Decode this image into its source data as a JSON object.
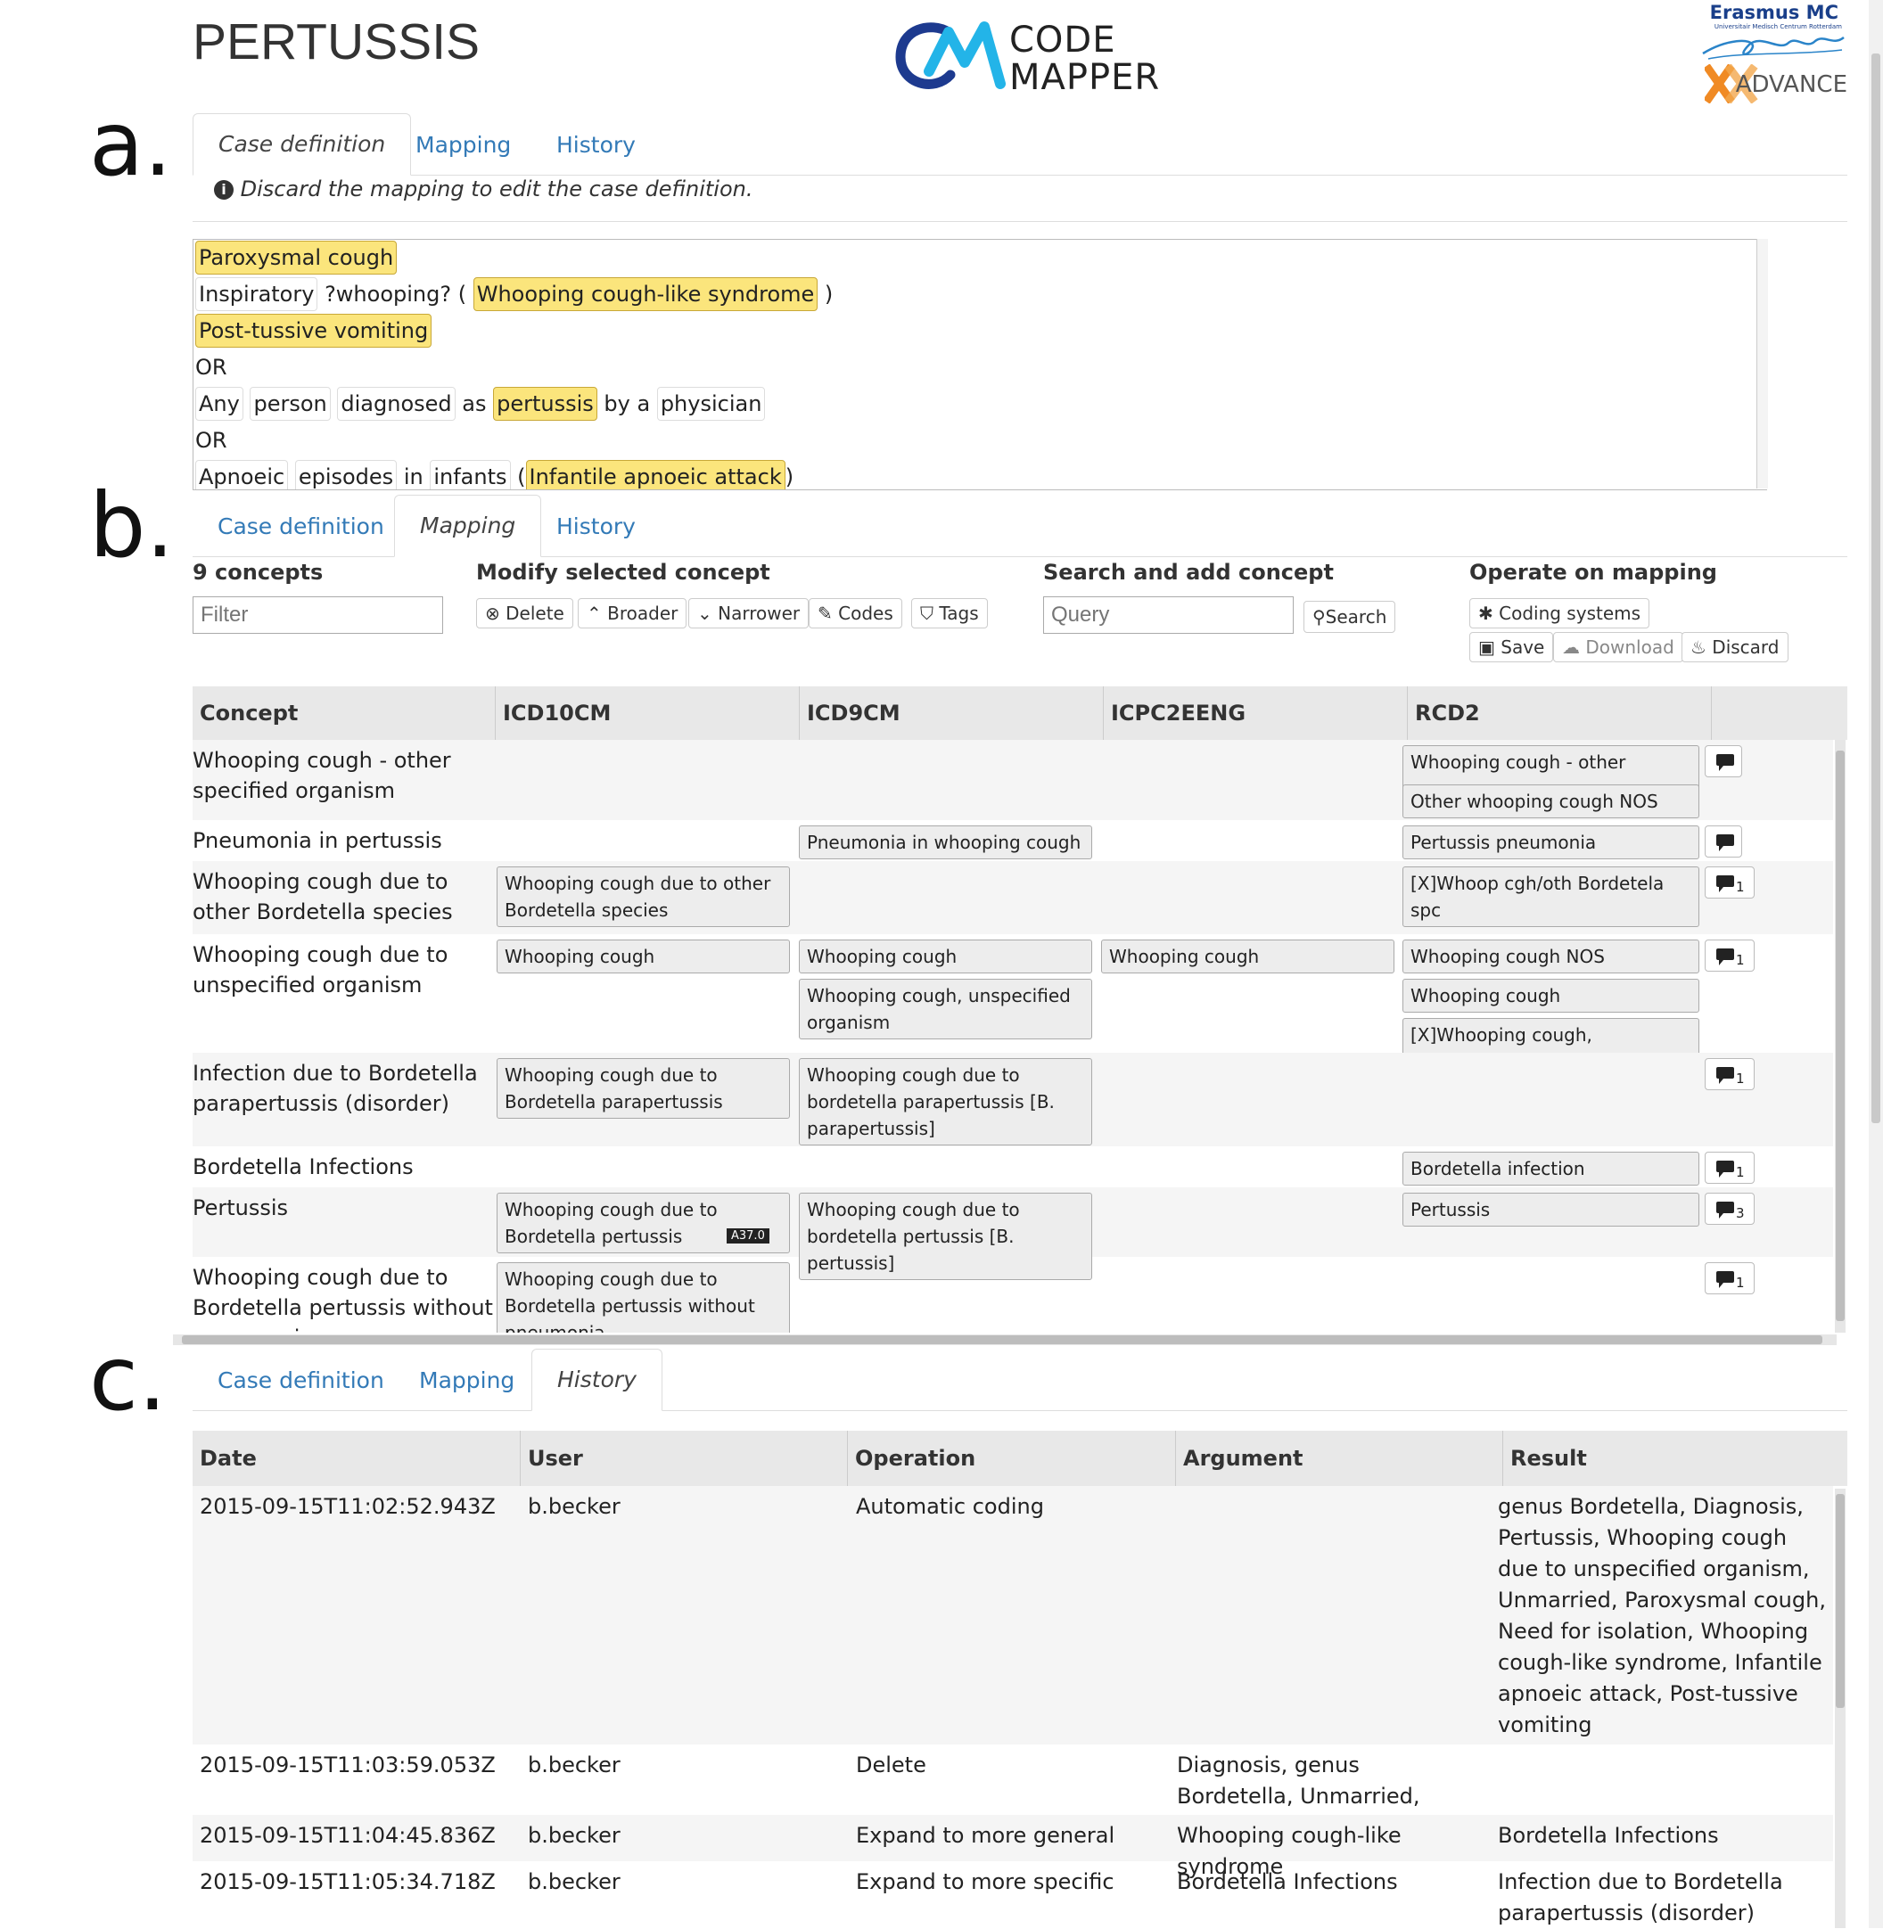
{
  "page_title": "PERTUSSIS",
  "logo": {
    "line1": "CODE",
    "line2": "MAPPER"
  },
  "partner": {
    "name": "Erasmus MC",
    "sub": "Universitair Medisch Centrum Rotterdam",
    "advance": "ADVANCE"
  },
  "panel_labels": {
    "a": "a.",
    "b": "b.",
    "c": "c."
  },
  "tabs": {
    "case_definition": "Case definition",
    "mapping": "Mapping",
    "history": "History"
  },
  "panel_a": {
    "notice": "Discard the mapping to edit the case definition.",
    "case_lines": [
      [
        {
          "t": "Paroxysmal cough",
          "hl": true
        }
      ],
      [
        {
          "t": "Inspiratory",
          "box": true
        },
        {
          "t": " ?whooping? ( "
        },
        {
          "t": "Whooping cough-like syndrome",
          "hl": true
        },
        {
          "t": " )"
        }
      ],
      [
        {
          "t": "Post-tussive vomiting",
          "hl": true
        }
      ],
      [
        {
          "t": "OR"
        }
      ],
      [
        {
          "t": "Any",
          "box": true
        },
        {
          "t": " "
        },
        {
          "t": "person",
          "box": true
        },
        {
          "t": " "
        },
        {
          "t": "diagnosed",
          "box": true
        },
        {
          "t": " as "
        },
        {
          "t": "pertussis",
          "hl": true
        },
        {
          "t": " by a "
        },
        {
          "t": "physician",
          "box": true
        }
      ],
      [
        {
          "t": "OR"
        }
      ],
      [
        {
          "t": "Apnoeic",
          "box": true
        },
        {
          "t": " "
        },
        {
          "t": "episodes",
          "box": true
        },
        {
          "t": " in "
        },
        {
          "t": "infants",
          "box": true
        },
        {
          "t": " ("
        },
        {
          "t": "Infantile apnoeic attack",
          "hl": true
        },
        {
          "t": ")"
        }
      ]
    ]
  },
  "panel_b": {
    "concept_count": "9 concepts",
    "filter_placeholder": "Filter",
    "modify_header": "Modify selected concept",
    "modify_buttons": {
      "delete": "Delete",
      "broader": "Broader",
      "narrower": "Narrower",
      "codes": "Codes",
      "tags": "Tags"
    },
    "search_header": "Search and add concept",
    "query_placeholder": "Query",
    "search_button": "Search",
    "operate_header": "Operate on mapping",
    "operate_buttons": {
      "coding_systems": "Coding systems",
      "save": "Save",
      "download": "Download",
      "discard": "Discard"
    },
    "columns": {
      "concept": "Concept",
      "c1": "ICD10CM",
      "c2": "ICD9CM",
      "c3": "ICPC2EENG",
      "c4": "RCD2"
    },
    "rows": [
      {
        "concept": "Whooping cough - other specified organism",
        "icd10": [],
        "icd9": [],
        "icpc": [],
        "rcd2": [
          "Whooping cough - other sp.org.",
          "Other whooping cough NOS"
        ],
        "comments": ""
      },
      {
        "concept": "Pneumonia in pertussis",
        "icd10": [],
        "icd9": [
          "Pneumonia in whooping cough"
        ],
        "icpc": [],
        "rcd2": [
          "Pertussis pneumonia"
        ],
        "comments": ""
      },
      {
        "concept": "Whooping cough due to other Bordetella species",
        "icd10": [
          "Whooping cough due to other Bordetella species"
        ],
        "icd9": [],
        "icpc": [],
        "rcd2": [
          "[X]Whoop cgh/oth Bordetela spc"
        ],
        "comments": "1"
      },
      {
        "concept": "Whooping cough due to unspecified organism",
        "icd10": [
          "Whooping cough"
        ],
        "icd9": [
          "Whooping cough",
          "Whooping cough, unspecified organism"
        ],
        "icpc": [
          "Whooping cough"
        ],
        "rcd2": [
          "Whooping cough NOS",
          "Whooping cough",
          "[X]Whooping cough, unspecified"
        ],
        "comments": "1"
      },
      {
        "concept": "Infection due to Bordetella parapertussis (disorder)",
        "icd10": [
          "Whooping cough due to Bordetella parapertussis"
        ],
        "icd9": [
          "Whooping cough due to bordetella parapertussis [B. parapertussis]"
        ],
        "icpc": [],
        "rcd2": [],
        "comments": "1"
      },
      {
        "concept": "Bordetella Infections",
        "icd10": [],
        "icd9": [],
        "icpc": [],
        "rcd2": [
          "Bordetella infection"
        ],
        "comments": "1"
      },
      {
        "concept": "Pertussis",
        "icd10": [
          "Whooping cough due to Bordetella pertussis"
        ],
        "icd10_badge": "A37.0",
        "icd9": [
          "Whooping cough due to bordetella pertussis [B. pertussis]"
        ],
        "icpc": [],
        "rcd2": [
          "Pertussis"
        ],
        "comments": "3"
      },
      {
        "concept": "Whooping cough due to Bordetella pertussis without pneumonia",
        "icd10": [
          "Whooping cough due to Bordetella pertussis without pneumonia"
        ],
        "icd9": [],
        "icpc": [],
        "rcd2": [],
        "comments": "1"
      }
    ]
  },
  "panel_c": {
    "columns": {
      "date": "Date",
      "user": "User",
      "operation": "Operation",
      "argument": "Argument",
      "result": "Result"
    },
    "rows": [
      {
        "date": "2015-09-15T11:02:52.943Z",
        "user": "b.becker",
        "operation": "Automatic coding",
        "argument": "",
        "result": "genus Bordetella, Diagnosis, Pertussis, Whooping cough due to unspecified organism, Unmarried, Paroxysmal cough, Need for isolation, Whooping cough-like syndrome, Infantile apnoeic attack, Post-tussive vomiting"
      },
      {
        "date": "2015-09-15T11:03:59.053Z",
        "user": "b.becker",
        "operation": "Delete",
        "argument": "Diagnosis, genus Bordetella, Unmarried, Need for isolation",
        "result": ""
      },
      {
        "date": "2015-09-15T11:04:45.836Z",
        "user": "b.becker",
        "operation": "Expand to more general",
        "argument": "Whooping cough-like syndrome",
        "result": "Bordetella Infections"
      },
      {
        "date": "2015-09-15T11:05:34.718Z",
        "user": "b.becker",
        "operation": "Expand to more specific",
        "argument": "Bordetella Infections",
        "result": "Infection due to Bordetella parapertussis (disorder)"
      }
    ]
  }
}
